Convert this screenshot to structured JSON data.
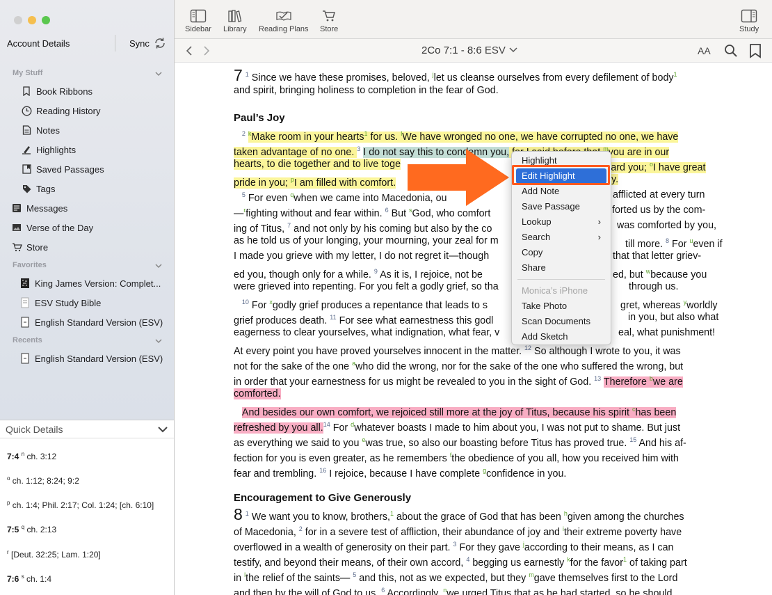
{
  "sidebar": {
    "account": "Account Details",
    "sync": "Sync",
    "sec_mystuff": "My Stuff",
    "mystuff": [
      {
        "icon": "bookmark-icon",
        "label": "Book Ribbons"
      },
      {
        "icon": "clock-icon",
        "label": "Reading History"
      },
      {
        "icon": "notes-icon",
        "label": "Notes"
      },
      {
        "icon": "highlighter-icon",
        "label": "Highlights"
      },
      {
        "icon": "saved-passage-icon",
        "label": "Saved Passages"
      },
      {
        "icon": "tag-icon",
        "label": "Tags"
      }
    ],
    "top_items": [
      {
        "icon": "messages-icon",
        "label": "Messages"
      },
      {
        "icon": "image-icon",
        "label": "Verse of the Day"
      },
      {
        "icon": "cart-icon",
        "label": "Store"
      }
    ],
    "sec_favorites": "Favorites",
    "favorites": [
      {
        "icon": "book-cover-icon",
        "label": "King James Version: Complet..."
      },
      {
        "icon": "book-cover-icon",
        "label": "ESV Study Bible"
      },
      {
        "icon": "book-cover-icon",
        "label": "English Standard Version (ESV)"
      }
    ],
    "sec_recents": "Recents",
    "recents": [
      {
        "icon": "book-cover-icon",
        "label": "English Standard Version (ESV)"
      }
    ]
  },
  "quick_details": {
    "title": "Quick Details",
    "rows": [
      {
        "verse": "7:4",
        "note": "n",
        "text": "ch. 3:12"
      },
      {
        "verse": "",
        "note": "o",
        "text": "ch. 1:12; 8:24; 9:2"
      },
      {
        "verse": "",
        "note": "p",
        "text": "ch. 1:4; Phil. 2:17; Col. 1:24; [ch. 6:10]"
      },
      {
        "verse": "7:5",
        "note": "q",
        "text": "ch. 2:13"
      },
      {
        "verse": "",
        "note": "r",
        "text": "[Deut. 32:25; Lam. 1:20]"
      },
      {
        "verse": "7:6",
        "note": "s",
        "text": "ch. 1:4"
      }
    ]
  },
  "toolbar": {
    "sidebar": "Sidebar",
    "library": "Library",
    "reading_plans": "Reading Plans",
    "store": "Store",
    "study": "Study"
  },
  "nav": {
    "reference": "2Co 7:1 - 8:6",
    "version": "ESV",
    "font": "AA"
  },
  "text": {
    "l1": {
      "ch": "7",
      "v": "1",
      "a": "Since we have these promises, beloved, ",
      "f": "j",
      "b": "let us cleanse ourselves from every defilement of body",
      "f2": "1"
    },
    "l2": "and spirit, bringing holiness to completion in the fear of God.",
    "h1": "Paul’s Joy",
    "l3": {
      "v": "2",
      "f": "k",
      "a": "Make room in your hearts",
      "f2": "1",
      "b": " for us. ",
      "f3": "l",
      "c": "We have wronged no one, we have corrupted no one, we have"
    },
    "l4": {
      "a": "taken advantage of no one. ",
      "v": "3",
      "b": "I do not say this to condemn you,",
      "c": " for I said before that ",
      "f": "m",
      "d": "you are in our"
    },
    "l5": {
      "a": "hearts, to die together and to live toge",
      "b": "ward you; ",
      "f": "o",
      "c": "I have great"
    },
    "l6": {
      "a": "pride in you; ",
      "f": "p",
      "b": "I am filled with comfort.",
      "c": "y."
    },
    "l7": {
      "v": "5",
      "a": "For even ",
      "f": "q",
      "b": "when we came into Macedonia, ou",
      "c": "afflicted at every turn"
    },
    "l8": {
      "a": "—",
      "f": "r",
      "b": "fighting without and fear within. ",
      "v": "6",
      "c": "But ",
      "f2": "s",
      "d": "God, who comfort",
      "e": "forted us by the com-"
    },
    "l9": {
      "a": "ing of Titus, ",
      "v": "7",
      "b": "and not only by his coming but also by the co",
      "c": "was comforted by you,"
    },
    "l10": {
      "a": "as he told us of your longing, your mourning, your zeal for m",
      "b": "till more. ",
      "v": "8",
      "c": "For ",
      "f": "u",
      "d": "even if"
    },
    "l11": {
      "a": "I made you grieve with my letter, I do not regret it—though ",
      "b": "that that letter griev-"
    },
    "l12": {
      "a": "ed you, though only for a while. ",
      "v": "9",
      "b": "As it is, I rejoice, not be",
      "c": "ed, but ",
      "f": "w",
      "d": "because you"
    },
    "l13": {
      "a": "were grieved into repenting. For you felt a godly grief, so tha",
      "b": "through us."
    },
    "l14": {
      "v": "10",
      "a": "For ",
      "f": "x",
      "b": "godly grief produces a repentance that leads to s",
      "c": "gret, whereas ",
      "f2": "y",
      "d": "worldly"
    },
    "l15": {
      "a": "grief produces death. ",
      "v": "11",
      "b": "For see what earnestness this godl",
      "c": "in you, but also what"
    },
    "l16": {
      "a": "eagerness to clear yourselves, what indignation, what fear, v",
      "b": "eal, what punishment!"
    },
    "l17": {
      "a": "At every point you have proved yourselves innocent in the matter. ",
      "v": "12",
      "b": "So although I wrote to you, it was"
    },
    "l18": {
      "a": "not for the sake of the one ",
      "f": "a",
      "b": "who did the wrong, nor for the sake of the one who suffered the wrong, but"
    },
    "l19": {
      "a": "in order that your earnestness for us might be revealed to you in the sight of God. ",
      "v": "13",
      "b": "Therefore ",
      "f": "b",
      "c": "we are"
    },
    "l20": "comforted.",
    "l21": {
      "a": "And besides our own comfort, we rejoiced still more at the joy of Titus, because his spirit ",
      "f": "c",
      "b": "has been"
    },
    "l22": {
      "a": "refreshed by you all.",
      "v": "14",
      "b": "For ",
      "f": "d",
      "c": "whatever boasts I made to him about you, I was not put to shame. But just"
    },
    "l23": {
      "a": "as everything we said to you ",
      "f": "e",
      "b": "was true, so also our boasting before Titus has proved true. ",
      "v": "15",
      "c": "And his af-"
    },
    "l24": {
      "a": "fection for you is even greater, as he remembers ",
      "f": "f",
      "b": "the obedience of you all, how you received him with"
    },
    "l25": {
      "a": "fear and trembling. ",
      "v": "16",
      "b": "I rejoice, because I have complete ",
      "f": "g",
      "c": "confidence in you."
    },
    "h2": "Encouragement to Give Generously",
    "l26": {
      "ch": "8",
      "v": "1",
      "a": "We want you to know, brothers,",
      "f": "1",
      "b": " about the grace of God that has been ",
      "f2": "h",
      "c": "given among the churches"
    },
    "l27": {
      "a": "of Macedonia, ",
      "v": "2",
      "b": "for in a severe test of affliction, their abundance of joy and ",
      "f": "i",
      "c": "their extreme poverty have"
    },
    "l28": {
      "a": "overflowed in a wealth of generosity on their part. ",
      "v": "3",
      "b": "For they gave ",
      "f": "j",
      "c": "according to their means, as I can"
    },
    "l29": {
      "a": "testify, and beyond their means, of their own accord, ",
      "v": "4",
      "b": "begging us earnestly ",
      "f": "k",
      "c": "for the favor",
      "f2": "1",
      "d": " of taking part"
    },
    "l30": {
      "a": "in ",
      "f": "l",
      "b": "the relief of the saints— ",
      "v": "5",
      "c": "and this, not as we expected, but they ",
      "f2": "m",
      "d": "gave themselves first to the Lord"
    },
    "l31": {
      "a": "and then by the will of God to us. ",
      "v": "6",
      "b": "Accordingly, ",
      "f": "n",
      "c": "we urged Titus that as he had started, so he should"
    }
  },
  "context_menu": {
    "items": [
      "Highlight",
      "Edit Highlight",
      "Add Note",
      "Save Passage",
      "Lookup",
      "Search",
      "Copy",
      "Share"
    ],
    "device_header": "Monica’s iPhone",
    "device_items": [
      "Take Photo",
      "Scan Documents",
      "Add Sketch"
    ],
    "selected": "Edit Highlight",
    "submenu_arrow": "›"
  },
  "colors": {
    "highlight_yellow": "#fbf59a",
    "highlight_pink": "#f8adc3",
    "highlight_green": "#c3ddd5",
    "annotation_orange": "#ff5a1f",
    "menu_selection": "#2e6fd8"
  }
}
